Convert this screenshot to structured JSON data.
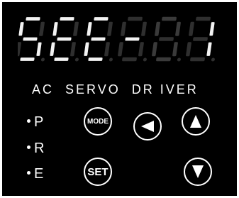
{
  "display": {
    "digits": [
      "S",
      "E",
      "E",
      "-",
      "0",
      "1"
    ],
    "segments": [
      [
        "a",
        "f",
        "g",
        "c",
        "d"
      ],
      [
        "a",
        "f",
        "g",
        "e",
        "d"
      ],
      [
        "a",
        "f",
        "g",
        "e",
        "d"
      ],
      [
        "g"
      ],
      [
        "a",
        "b",
        "c",
        "d",
        "e",
        "f"
      ],
      [
        "b",
        "c"
      ]
    ],
    "dim_digit_index": 4,
    "colors": {
      "lit": "#f2f2f2",
      "unlit": "#2f2f2f"
    }
  },
  "panel": {
    "title": "AC  SERVO  DR IVER",
    "background": "#000000"
  },
  "indicators": [
    {
      "label": "P"
    },
    {
      "label": "R"
    },
    {
      "label": "E"
    }
  ],
  "buttons": {
    "mode": "MODE",
    "set": "SET",
    "left": "left-arrow-icon",
    "up": "up-arrow-icon",
    "down": "down-arrow-icon"
  }
}
